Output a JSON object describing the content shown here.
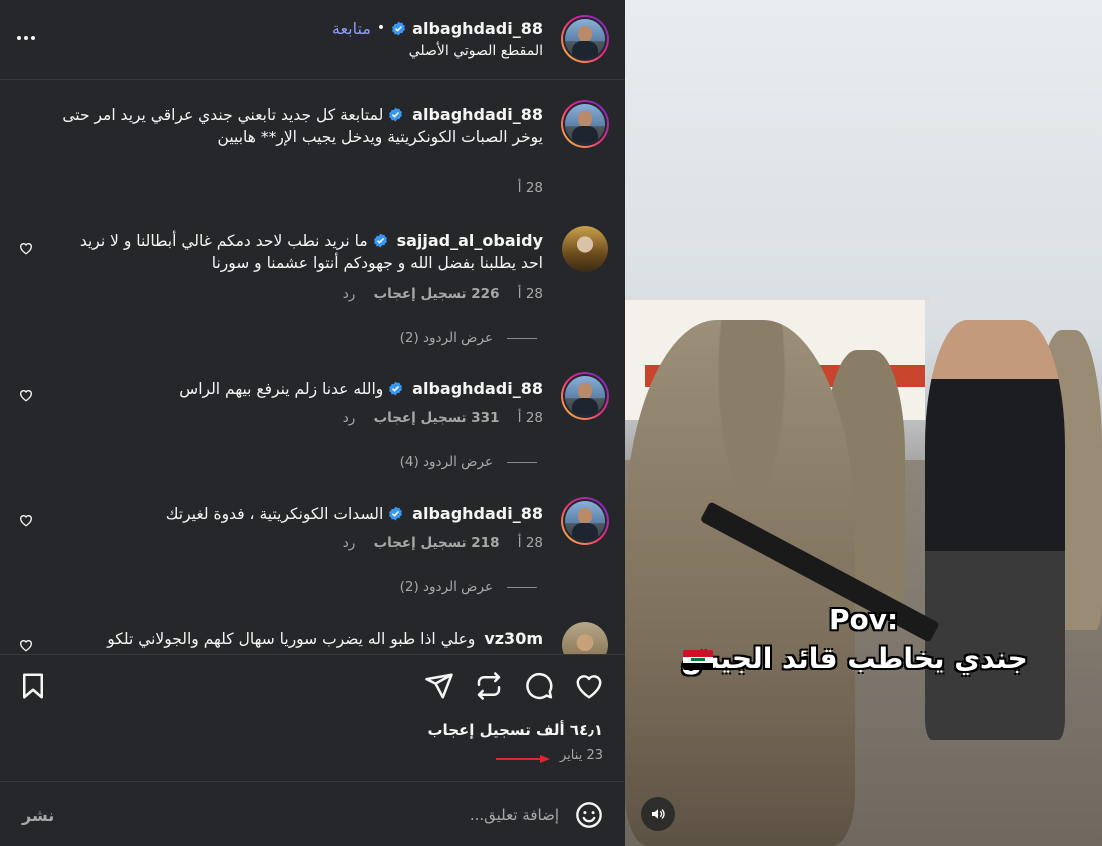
{
  "header": {
    "username": "albaghdadi_88",
    "follow_label": "متابعة",
    "separator": "•",
    "audio_label": "المقطع الصوتي الأصلي"
  },
  "comments": [
    {
      "username": "albaghdadi_88",
      "text": "لمتابعة كل جديد تابعني جندي عراقي يريد امر حتى يوخر الصبات الكونكريتية ويدخل يجيب الإر** هابيين",
      "time": "28 أ"
    },
    {
      "username": "sajjad_al_obaidy",
      "text": "ما نريد نطب لاحد دمكم غالي أبطالنا و لا نريد احد يطلبنا بفضل الله و جهودكم أنتوا عشمنا و سورنا",
      "time": "28 أ",
      "likes": "226 تسجيل إعجاب",
      "reply": "رد",
      "replies": "عرض الردود (2)"
    },
    {
      "username": "albaghdadi_88",
      "text": "والله عدنا زلم ينرفع بيهم الراس",
      "time": "28 أ",
      "likes": "331 تسجيل إعجاب",
      "reply": "رد",
      "replies": "عرض الردود (4)"
    },
    {
      "username": "albaghdadi_88",
      "text": "السدات الكونكريتية ، فدوة لغيرتك",
      "time": "28 أ",
      "likes": "218 تسجيل إعجاب",
      "reply": "رد",
      "replies": "عرض الردود (2)"
    },
    {
      "username": "vz30m",
      "text": "وعلي اذا طبو اله يضرب سوريا سهال كلهم والجولاني تلكو"
    }
  ],
  "actions": {
    "likes_count": "٦٤٫١ ألف تسجيل إعجاب",
    "date": "23 يناير"
  },
  "composer": {
    "placeholder": "إضافة تعليق...",
    "post_label": "نشر"
  },
  "video": {
    "pov_text": "Pov:",
    "caption": "جندي يخاطب قائد الجيش"
  },
  "colors": {
    "background": "#25272b",
    "link": "#8c9cf7",
    "verified": "#3897f0",
    "arrow": "#e0262a"
  }
}
